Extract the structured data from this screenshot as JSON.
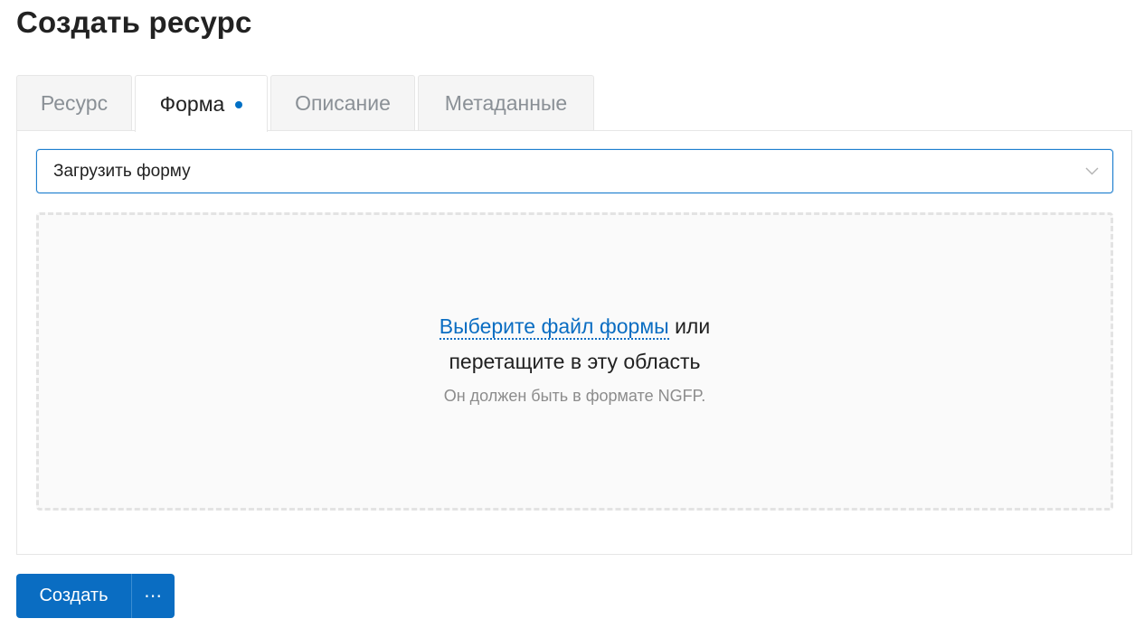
{
  "header": {
    "title": "Создать ресурс"
  },
  "tabs": [
    {
      "label": "Ресурс",
      "active": false
    },
    {
      "label": "Форма",
      "active": true,
      "modified": true
    },
    {
      "label": "Описание",
      "active": false
    },
    {
      "label": "Метаданные",
      "active": false
    }
  ],
  "form": {
    "source_select": {
      "value": "Загрузить форму"
    },
    "dropzone": {
      "link_text": "Выберите файл формы",
      "after_link": " или",
      "line2": "перетащите в эту область",
      "hint": "Он должен быть в формате NGFP."
    }
  },
  "actions": {
    "create_label": "Создать",
    "more_label": "⋯"
  },
  "colors": {
    "accent": "#0a6dc2",
    "tab_dot": "#0070c5"
  }
}
